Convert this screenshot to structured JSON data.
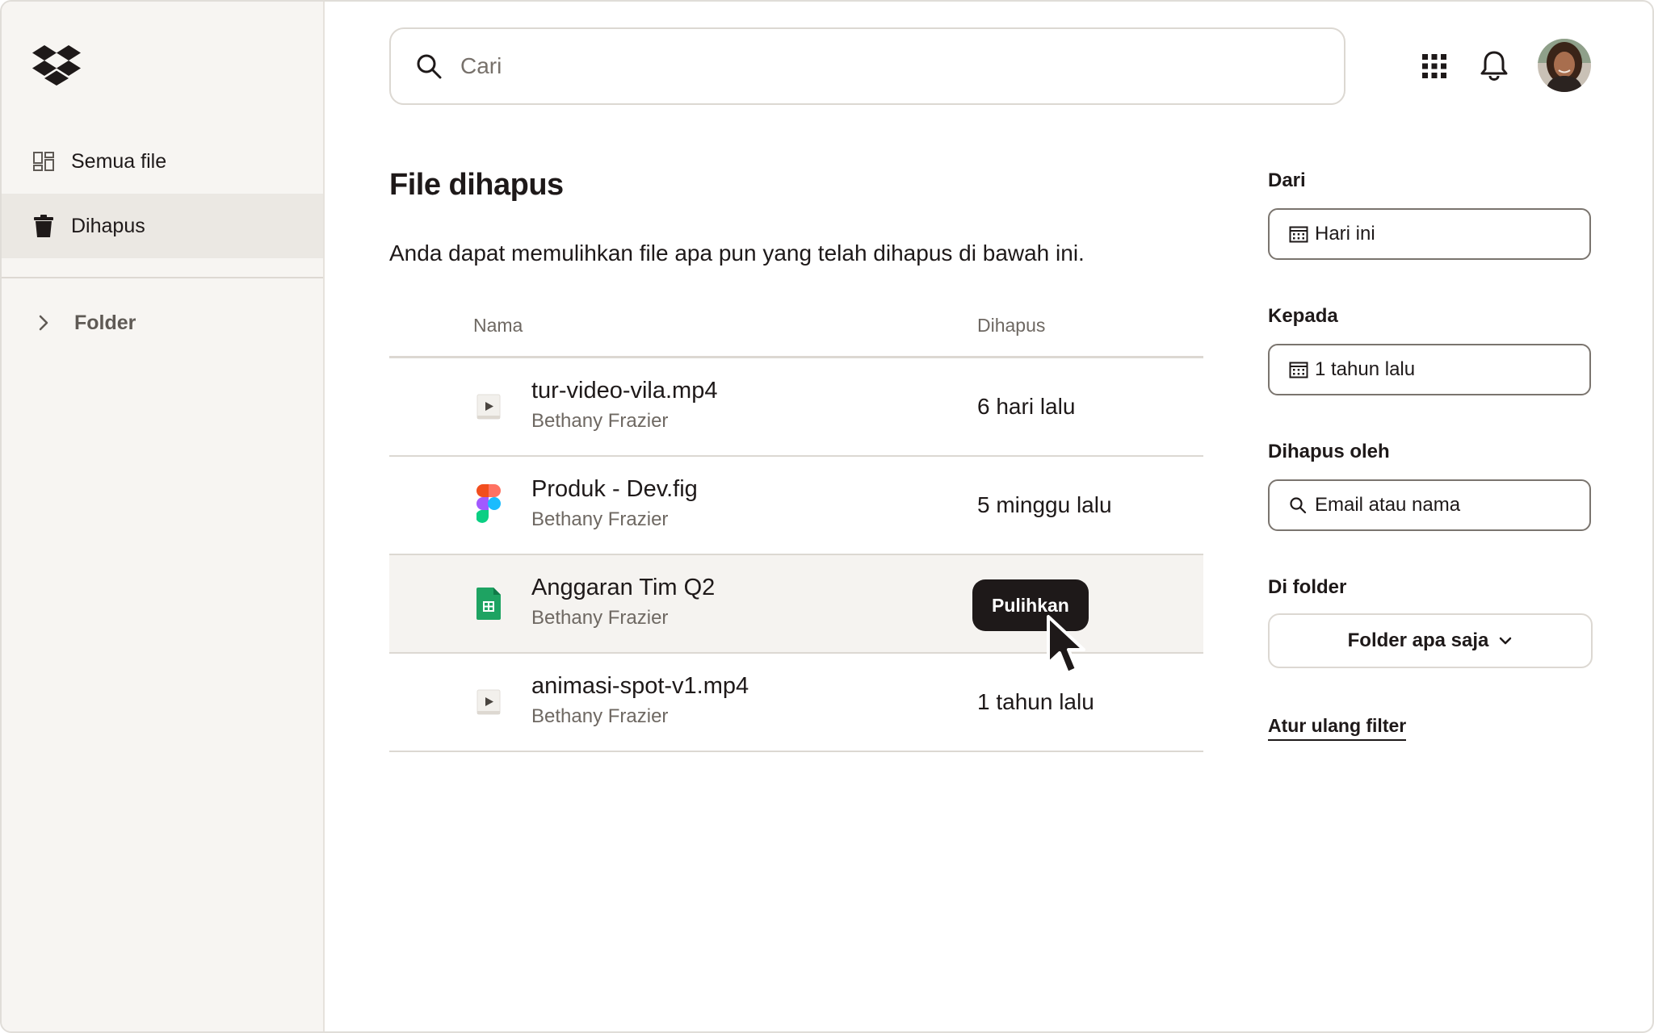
{
  "sidebar": {
    "items": [
      {
        "label": "Semua file",
        "icon": "grid-files-icon"
      },
      {
        "label": "Dihapus",
        "icon": "trash-icon"
      }
    ],
    "folder_label": "Folder"
  },
  "search": {
    "placeholder": "Cari"
  },
  "main": {
    "title": "File dihapus",
    "description": "Anda dapat memulihkan file apa pun yang telah dihapus di bawah ini.",
    "columns": {
      "name": "Nama",
      "deleted": "Dihapus"
    },
    "rows": [
      {
        "name": "tur-video-vila.mp4",
        "owner": "Bethany Frazier",
        "deleted": "6 hari lalu",
        "icon": "video-file-icon"
      },
      {
        "name": "Produk - Dev.fig",
        "owner": "Bethany Frazier",
        "deleted": "5 minggu lalu",
        "icon": "figma-file-icon"
      },
      {
        "name": "Anggaran Tim Q2",
        "owner": "Bethany Frazier",
        "deleted": "",
        "icon": "sheet-file-icon",
        "action": "Pulihkan"
      },
      {
        "name": "animasi-spot-v1.mp4",
        "owner": "Bethany Frazier",
        "deleted": "1 tahun lalu",
        "icon": "video-file-icon"
      }
    ]
  },
  "filters": {
    "from_label": "Dari",
    "from_value": "Hari ini",
    "to_label": "Kepada",
    "to_value": "1 tahun lalu",
    "deleted_by_label": "Dihapus oleh",
    "deleted_by_placeholder": "Email atau nama",
    "folder_label": "Di folder",
    "folder_value": "Folder apa saja",
    "reset_label": "Atur ulang filter"
  },
  "colors": {
    "sidebar_bg": "#f7f5f2",
    "selected_bg": "#ebe8e3",
    "primary_button": "#1e1919",
    "sheet_green": "#1ea362"
  }
}
